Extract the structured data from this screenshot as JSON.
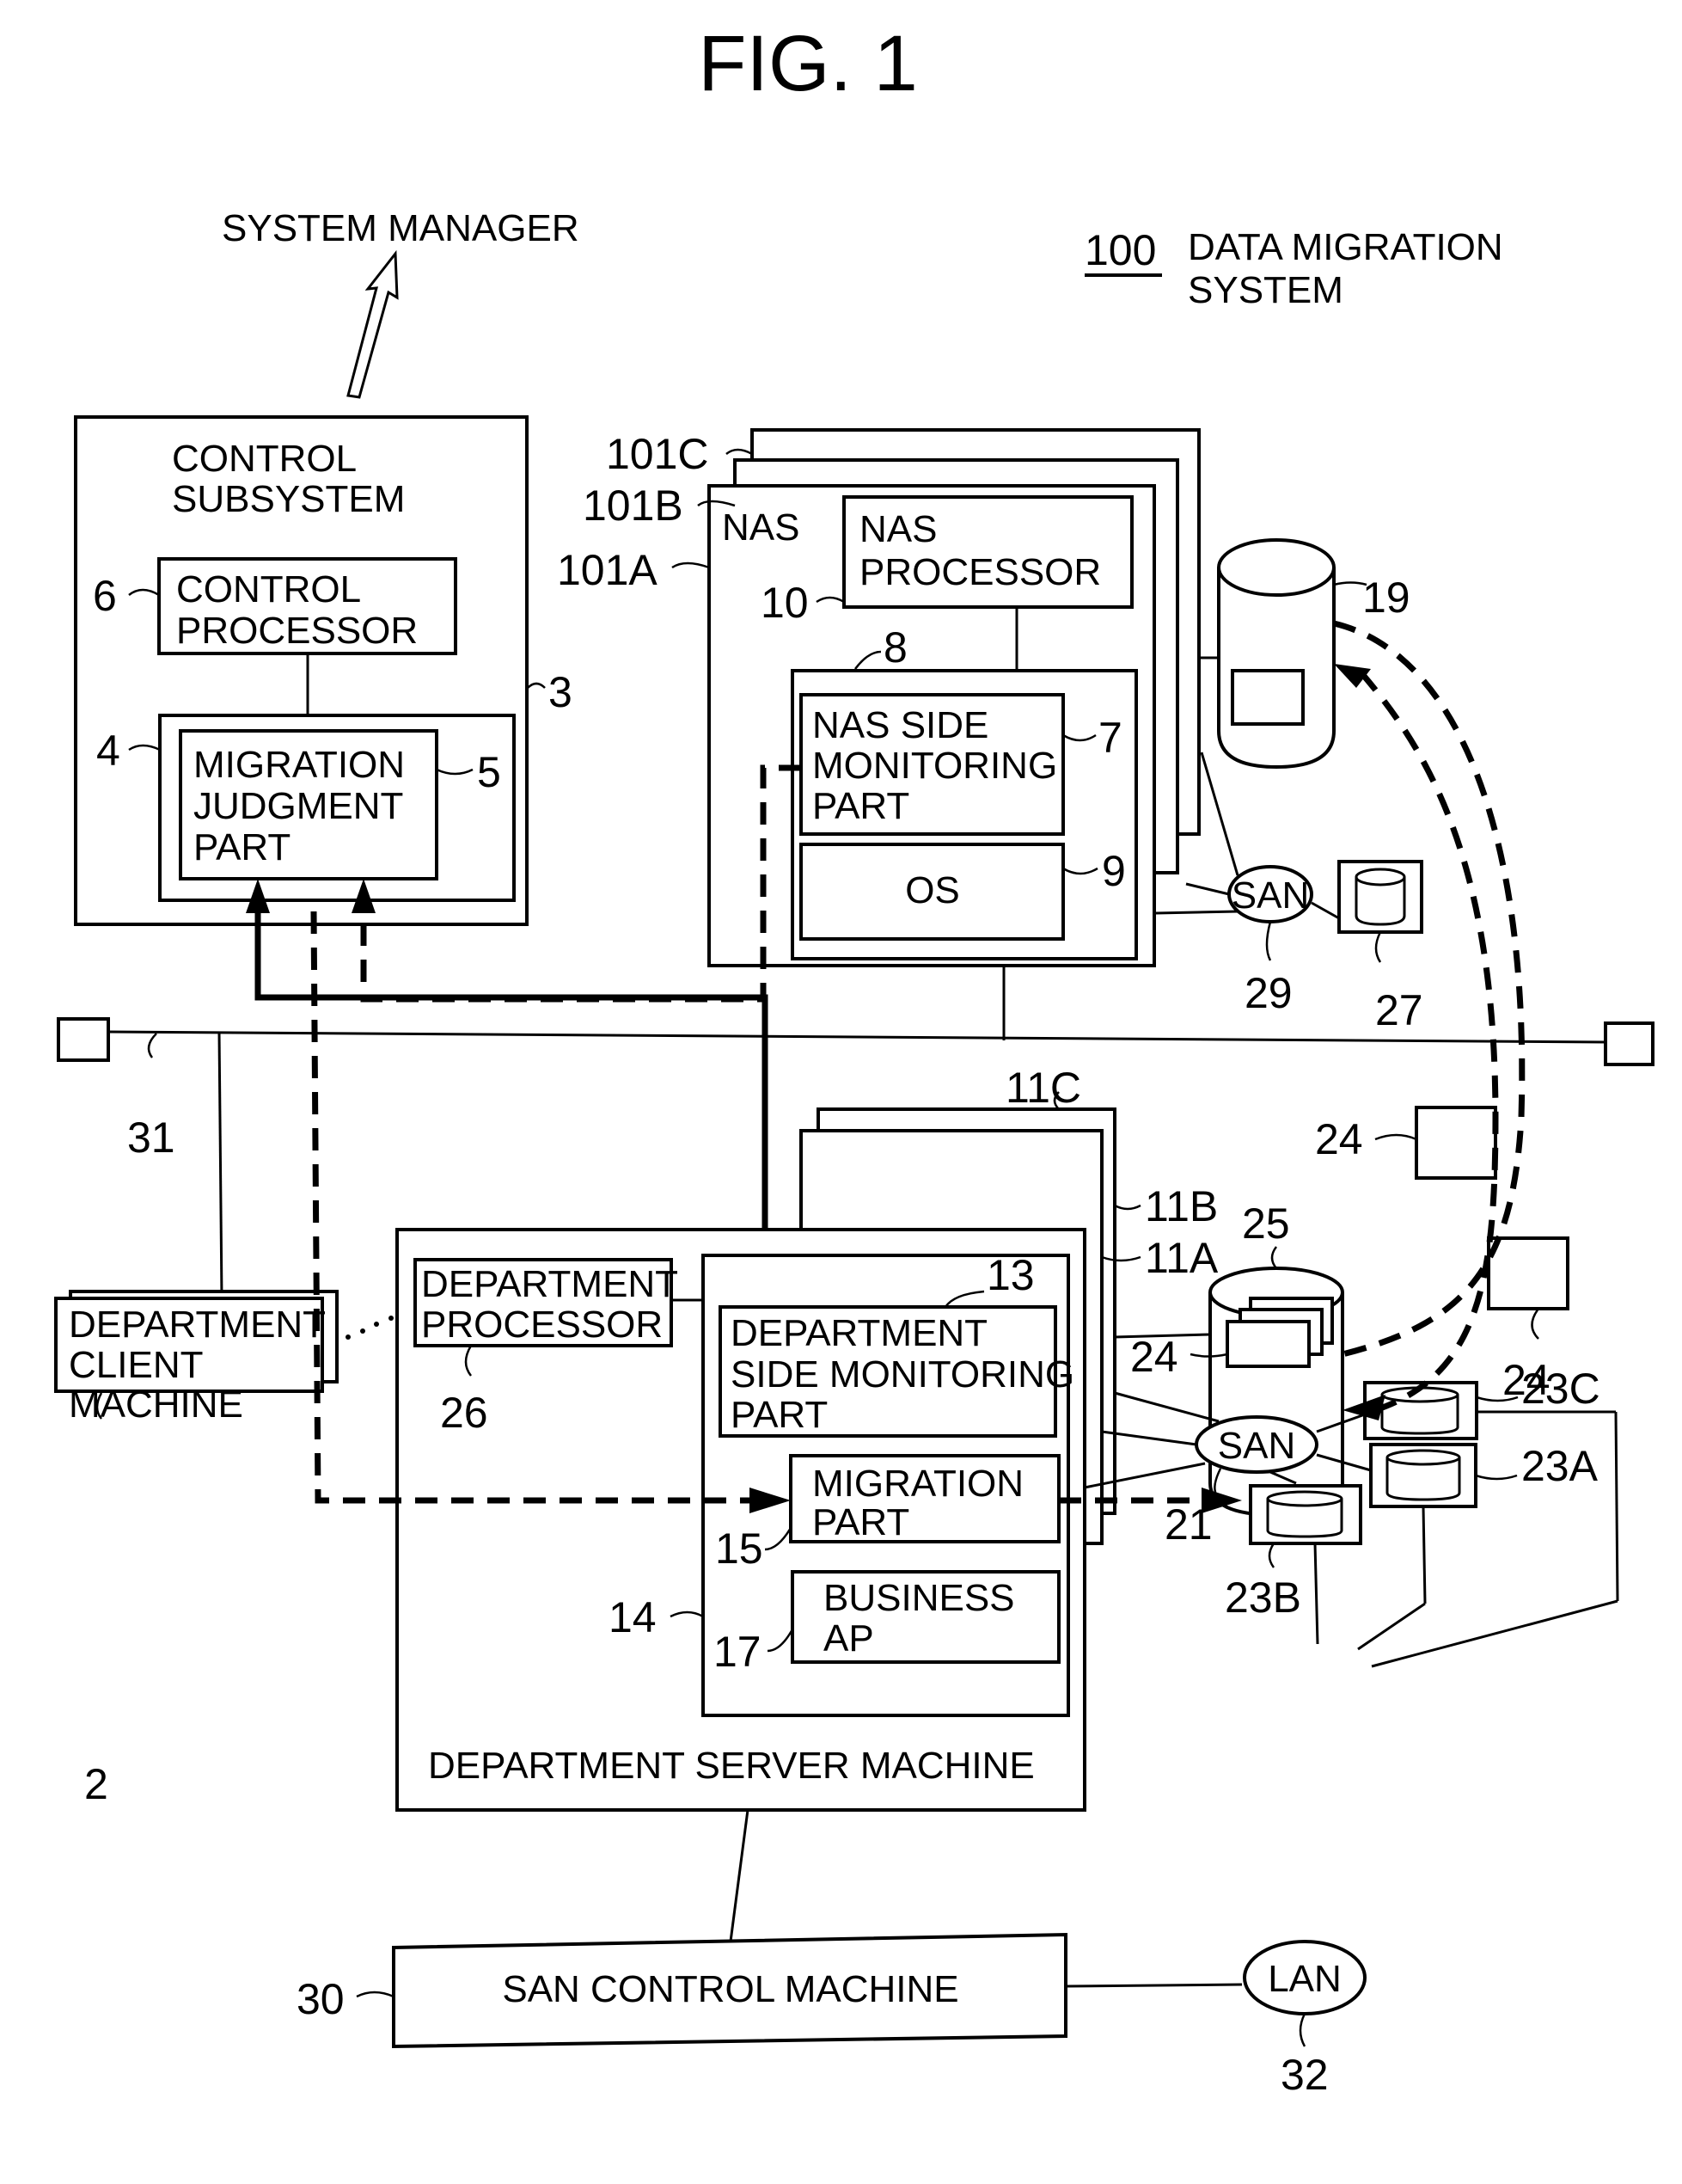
{
  "figure": {
    "title": "FIG. 1",
    "system_ref": "100",
    "system_label_line1": "DATA MIGRATION",
    "system_label_line2": "SYSTEM",
    "system_manager": "SYSTEM MANAGER"
  },
  "control_subsystem": {
    "title_line1": "CONTROL",
    "title_line2": "SUBSYSTEM",
    "ref": "3",
    "processor": {
      "line1": "CONTROL",
      "line2": "PROCESSOR",
      "ref": "6"
    },
    "memory_ref": "4",
    "judgment_part": {
      "line1": "MIGRATION",
      "line2": "JUDGMENT",
      "line3": "PART",
      "ref": "5"
    }
  },
  "nas": {
    "label": "NAS",
    "refs": [
      "101A",
      "101B",
      "101C"
    ],
    "processor": {
      "line1": "NAS",
      "line2": "PROCESSOR",
      "ref": "10"
    },
    "memory_ref": "8",
    "monitoring_part": {
      "line1": "NAS SIDE",
      "line2": "MONITORING",
      "line3": "PART",
      "ref": "7"
    },
    "os": {
      "label": "OS",
      "ref": "9"
    },
    "storage_ref": "19",
    "san": {
      "label": "SAN",
      "ref": "29"
    },
    "disk_ref": "27"
  },
  "network": {
    "lan_ref": "31",
    "file_ref": "24"
  },
  "department_server": {
    "label": "DEPARTMENT SERVER MACHINE",
    "refs": [
      "11A",
      "11B",
      "11C"
    ],
    "processor": {
      "line1": "DEPARTMENT",
      "line2": "PROCESSOR",
      "ref": "26"
    },
    "memory_ref": "14",
    "monitoring_part": {
      "line1": "DEPARTMENT",
      "line2": "SIDE MONITORING",
      "line3": "PART",
      "ref": "13"
    },
    "migration_part": {
      "line1": "MIGRATION",
      "line2": "PART",
      "ref": "15"
    },
    "business_ap": {
      "line1": "BUSINESS",
      "line2": "AP",
      "ref": "17"
    },
    "storage_ref": "25",
    "file_ref": "24",
    "san": {
      "label": "SAN",
      "ref": "21"
    },
    "disks": [
      "23A",
      "23B",
      "23C"
    ]
  },
  "client": {
    "line1": "DEPARTMENT",
    "line2": "CLIENT",
    "line3": "MACHINE",
    "ref": "2"
  },
  "san_control": {
    "label": "SAN CONTROL MACHINE",
    "ref": "30"
  },
  "lan": {
    "label": "LAN",
    "ref": "32"
  }
}
